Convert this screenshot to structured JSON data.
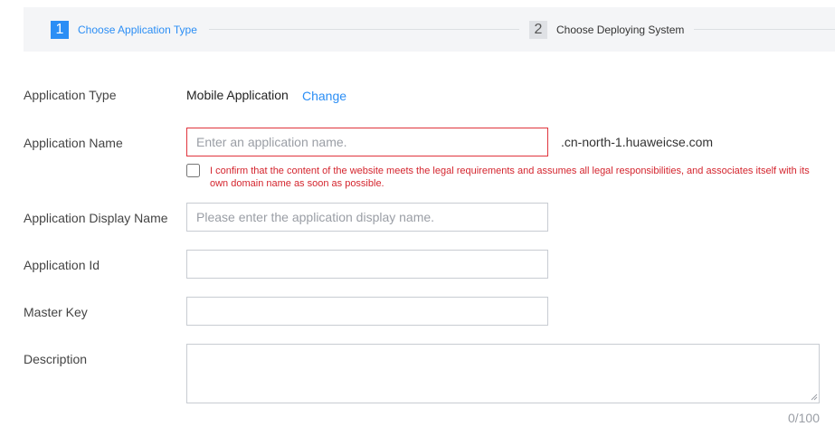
{
  "steps": [
    {
      "number": "1",
      "label": "Choose Application Type"
    },
    {
      "number": "2",
      "label": "Choose Deploying System"
    }
  ],
  "form": {
    "app_type": {
      "label": "Application Type",
      "value": "Mobile Application",
      "change_link": "Change"
    },
    "app_name": {
      "label": "Application Name",
      "placeholder": "Enter an application name.",
      "domain_suffix": ".cn-north-1.huaweicse.com"
    },
    "confirm": {
      "text": "I confirm that the content of the website meets the legal requirements and assumes all legal responsibilities, and associates itself with its own domain name as soon as possible.",
      "checked": false
    },
    "display_name": {
      "label": "Application Display Name",
      "placeholder": "Please enter the application display name."
    },
    "app_id": {
      "label": "Application Id",
      "value": ""
    },
    "master_key": {
      "label": "Master Key",
      "value": ""
    },
    "description": {
      "label": "Description",
      "value": "",
      "counter": "0/100"
    }
  },
  "colors": {
    "accent": "#2b8ef5",
    "error": "#e0343d",
    "error_text": "#d4252e",
    "steps_bg": "#f4f5f7"
  }
}
